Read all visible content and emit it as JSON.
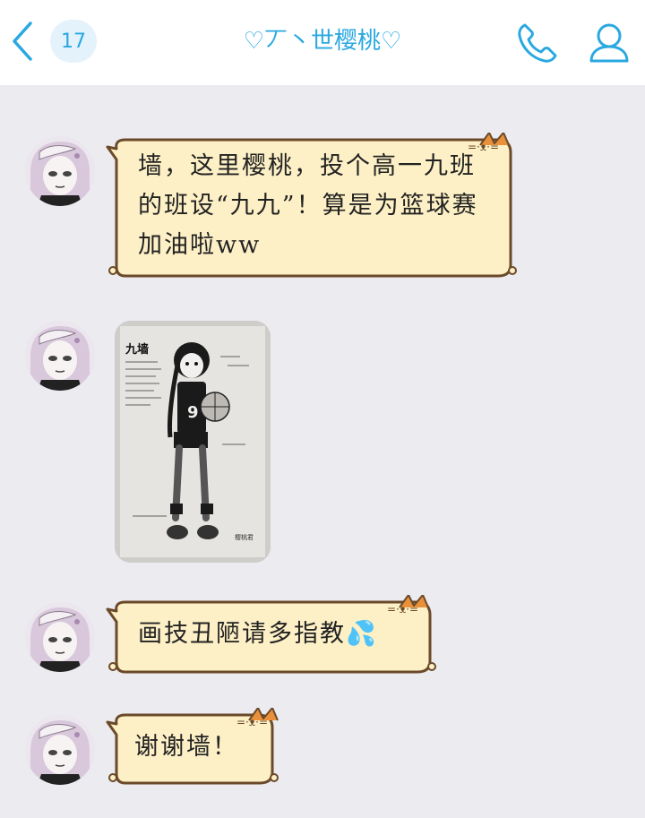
{
  "header": {
    "unread_count": "17",
    "title": "♡丆丶世樱桃♡"
  },
  "messages": [
    {
      "text": "墙，这里樱桃，投个高一九班的班设“九九”！算是为篮球赛加油啦ww"
    },
    {
      "image": "drawing"
    },
    {
      "text": "画技丑陋请多指教💦"
    },
    {
      "text": "谢谢墙！"
    }
  ],
  "drawing": {
    "heading": "九墙",
    "jersey_number": "9",
    "signature": "樱桃君"
  },
  "colors": {
    "accent": "#2aa8e0",
    "bubble_fill": "#fdf0c6",
    "bubble_border": "#6b4a2a",
    "background": "#ebebf0"
  }
}
